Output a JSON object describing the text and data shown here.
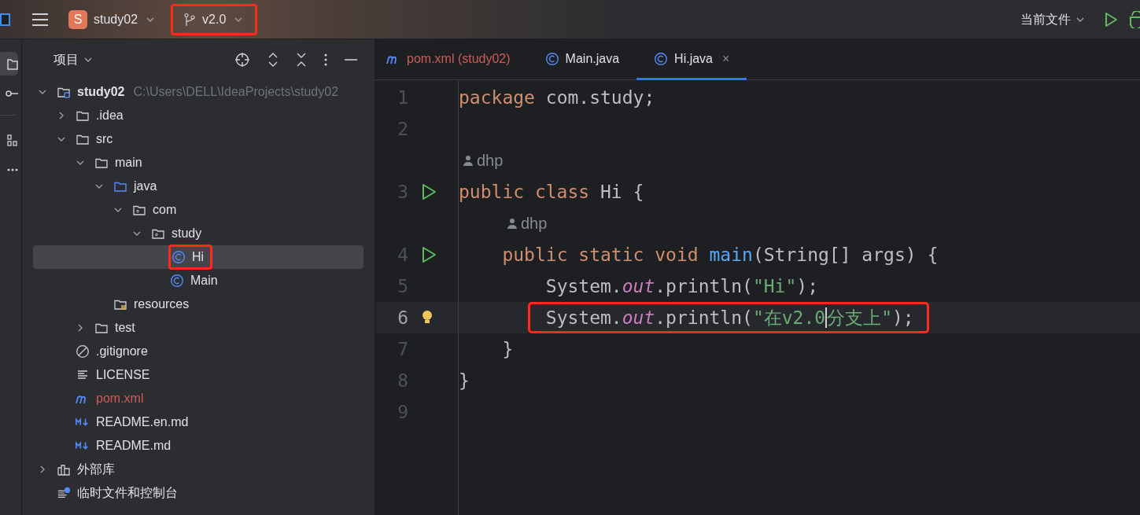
{
  "title_bar": {
    "project_letter": "S",
    "project": "study02",
    "branch": "v2.0",
    "branch_boxed": true,
    "run_config": "当前文件"
  },
  "tool_strip": [
    {
      "kind": "folder",
      "selected": true
    },
    {
      "kind": "commit",
      "selected": false
    },
    {
      "kind": "structure",
      "selected": false
    },
    {
      "kind": "more",
      "selected": false
    }
  ],
  "project_panel": {
    "title": "项目",
    "tree": [
      {
        "label": "study02",
        "path": "C:\\Users\\DELL\\IdeaProjects\\study02",
        "kind": "module",
        "expanded": true,
        "selected": false,
        "boxed": false,
        "children": [
          {
            "label": ".idea",
            "kind": "folder",
            "expanded": false,
            "selected": false,
            "boxed": false
          },
          {
            "label": "src",
            "kind": "folder",
            "expanded": true,
            "selected": false,
            "boxed": false,
            "children": [
              {
                "label": "main",
                "kind": "folder",
                "expanded": true,
                "selected": false,
                "boxed": false,
                "children": [
                  {
                    "label": "java",
                    "kind": "source",
                    "expanded": true,
                    "selected": false,
                    "boxed": false,
                    "children": [
                      {
                        "label": "com",
                        "kind": "package",
                        "expanded": true,
                        "selected": false,
                        "boxed": false,
                        "children": [
                          {
                            "label": "study",
                            "kind": "package",
                            "expanded": true,
                            "selected": false,
                            "boxed": false,
                            "children": [
                              {
                                "label": "Hi",
                                "kind": "class",
                                "selected": true,
                                "boxed": true
                              },
                              {
                                "label": "Main",
                                "kind": "class",
                                "selected": false,
                                "boxed": false
                              }
                            ]
                          }
                        ]
                      }
                    ]
                  },
                  {
                    "label": "resources",
                    "kind": "resources",
                    "selected": false,
                    "boxed": false
                  }
                ]
              },
              {
                "label": "test",
                "kind": "folder",
                "expanded": false,
                "selected": false,
                "boxed": false
              }
            ]
          },
          {
            "label": ".gitignore",
            "kind": "ignore",
            "selected": false,
            "boxed": false
          },
          {
            "label": "LICENSE",
            "kind": "text",
            "selected": false,
            "boxed": false
          },
          {
            "label": "pom.xml",
            "kind": "maven",
            "selected": false,
            "boxed": false,
            "modified": true
          },
          {
            "label": "README.en.md",
            "kind": "markdown",
            "selected": false,
            "boxed": false
          },
          {
            "label": "README.md",
            "kind": "markdown",
            "selected": false,
            "boxed": false
          }
        ]
      },
      {
        "label": "外部库",
        "kind": "library",
        "expanded": false,
        "selected": false,
        "boxed": false
      },
      {
        "label": "临时文件和控制台",
        "kind": "scratch",
        "selected": false,
        "boxed": false
      }
    ]
  },
  "editor_tabs": [
    {
      "label": "pom.xml (study02)",
      "kind": "maven",
      "selected": false,
      "modified": true
    },
    {
      "label": "Main.java",
      "kind": "class",
      "selected": false,
      "modified": false
    },
    {
      "label": "Hi.java",
      "kind": "class",
      "selected": true,
      "modified": false,
      "close": "×"
    }
  ],
  "code": [
    {
      "kind": "line",
      "number": "1",
      "run": false,
      "hint": false,
      "current": false,
      "boxed": false,
      "tokens": [
        {
          "kind": "keyword",
          "text": "package"
        },
        {
          "kind": "plain",
          "text": " com.study;"
        }
      ]
    },
    {
      "kind": "line",
      "number": "2",
      "run": false,
      "hint": false,
      "current": false
    },
    {
      "kind": "author",
      "indent": false,
      "text": "dhp"
    },
    {
      "kind": "line",
      "number": "3",
      "run": true,
      "hint": false,
      "current": false,
      "boxed": false,
      "tokens": [
        {
          "kind": "keyword",
          "text": "public class"
        },
        {
          "kind": "plain",
          "text": " Hi {"
        }
      ]
    },
    {
      "kind": "author",
      "indent": true,
      "text": "dhp"
    },
    {
      "kind": "line",
      "number": "4",
      "run": true,
      "hint": false,
      "current": false,
      "boxed": false,
      "tokens": [
        {
          "kind": "keyword",
          "text": "    public static void"
        },
        {
          "kind": "method",
          "text": " main"
        },
        {
          "kind": "plain",
          "text": "(String[] args) {"
        }
      ]
    },
    {
      "kind": "line",
      "number": "5",
      "run": false,
      "hint": false,
      "current": false,
      "boxed": false,
      "tokens": [
        {
          "kind": "plain",
          "text": "        System."
        },
        {
          "kind": "field",
          "text": "out"
        },
        {
          "kind": "plain",
          "text": ".println("
        },
        {
          "kind": "string",
          "text": "\"Hi\""
        },
        {
          "kind": "plain",
          "text": ");"
        }
      ]
    },
    {
      "kind": "line",
      "number": "6",
      "run": false,
      "hint": true,
      "current": true,
      "boxed": true,
      "tokens": [
        {
          "kind": "plain",
          "text": "        System."
        },
        {
          "kind": "field",
          "text": "out"
        },
        {
          "kind": "plain",
          "text": ".println("
        },
        {
          "kind": "string",
          "text": "\"在v2.0",
          "caret": true
        },
        {
          "kind": "string",
          "text": "分支上\"",
          "caret": false
        },
        {
          "kind": "plain",
          "text": ");"
        }
      ]
    },
    {
      "kind": "line",
      "number": "7",
      "run": false,
      "hint": false,
      "current": false,
      "boxed": false,
      "tokens": [
        {
          "kind": "plain",
          "text": "    }"
        }
      ]
    },
    {
      "kind": "line",
      "number": "8",
      "run": false,
      "hint": false,
      "current": false,
      "boxed": false,
      "tokens": [
        {
          "kind": "plain",
          "text": "}"
        }
      ]
    },
    {
      "kind": "line",
      "number": "9",
      "run": false,
      "hint": false,
      "current": false
    }
  ]
}
